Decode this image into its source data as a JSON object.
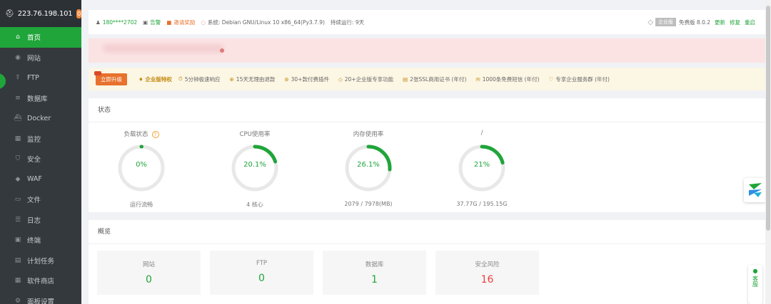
{
  "sidebar": {
    "ip": "223.76.198.101",
    "badge": "0",
    "items": [
      {
        "label": "首页",
        "icon": "home-icon",
        "glyph": "⌂",
        "active": true
      },
      {
        "label": "网站",
        "icon": "globe-icon",
        "glyph": "◉"
      },
      {
        "label": "FTP",
        "icon": "ftp-icon",
        "glyph": "⇪"
      },
      {
        "label": "数据库",
        "icon": "database-icon",
        "glyph": "≡"
      },
      {
        "label": "Docker",
        "icon": "docker-icon",
        "glyph": "⛴"
      },
      {
        "label": "监控",
        "icon": "monitor-icon",
        "glyph": "▦"
      },
      {
        "label": "安全",
        "icon": "shield-icon",
        "glyph": "⛉"
      },
      {
        "label": "WAF",
        "icon": "waf-icon",
        "glyph": "◆"
      },
      {
        "label": "文件",
        "icon": "folder-icon",
        "glyph": "▭"
      },
      {
        "label": "日志",
        "icon": "log-icon",
        "glyph": "☰"
      },
      {
        "label": "终端",
        "icon": "terminal-icon",
        "glyph": "▣"
      },
      {
        "label": "计划任务",
        "icon": "schedule-icon",
        "glyph": "▤"
      },
      {
        "label": "软件商店",
        "icon": "store-icon",
        "glyph": "▦"
      },
      {
        "label": "面板设置",
        "icon": "settings-icon",
        "glyph": "⚙"
      }
    ]
  },
  "topbar": {
    "user": "180****2702",
    "alert": "告警",
    "invite": "邀请奖励",
    "system_label": "系统:",
    "system": "Debian GNU/Linux 10 x86_64(Py3.7.9)",
    "uptime": "持续运行: 9天",
    "edition_tag": "企业版",
    "version": "免费版 8.0.2",
    "update": "更新",
    "repair": "修复",
    "restart": "重启"
  },
  "promo": {
    "button": "立即升级",
    "vip": "企业版特权",
    "items": [
      "5分钟极速响应",
      "15天无理由退款",
      "30+款付费插件",
      "20+企业版专享功能",
      "2张SSL商用证书 (年付)",
      "1000条免费短信 (年付)",
      "专享企业服务群 (年付)"
    ]
  },
  "status": {
    "title": "状态",
    "gauges": [
      {
        "title": "负载状态",
        "value": "0%",
        "percent": 0,
        "sub": "运行流畅",
        "help": "?"
      },
      {
        "title": "CPU使用率",
        "value": "20.1%",
        "percent": 20.1,
        "sub": "4 核心"
      },
      {
        "title": "内存使用率",
        "value": "26.1%",
        "percent": 26.1,
        "sub": "2079 / 7978(MB)"
      },
      {
        "title": "/",
        "value": "21%",
        "percent": 21,
        "sub": "37.77G / 195.15G"
      }
    ]
  },
  "overview": {
    "title": "概览",
    "cards": [
      {
        "label": "网站",
        "value": "0"
      },
      {
        "label": "FTP",
        "value": "0"
      },
      {
        "label": "数据库",
        "value": "1"
      },
      {
        "label": "安全风险",
        "value": "16",
        "danger": true
      }
    ]
  },
  "colors": {
    "accent": "#20a53a",
    "danger": "#ef3d3d",
    "sidebar": "#34393d"
  },
  "service": {
    "label": "客服"
  }
}
